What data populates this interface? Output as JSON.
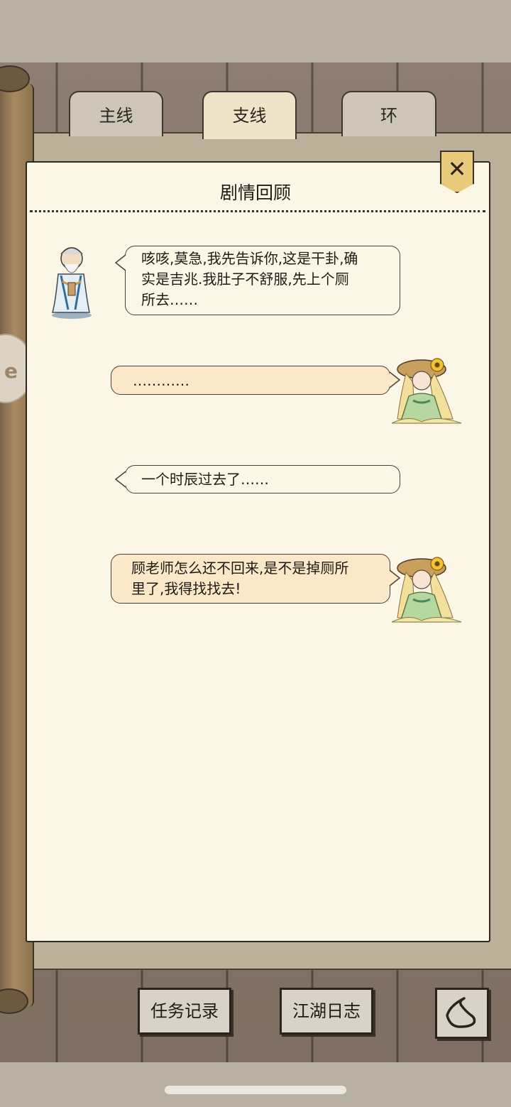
{
  "tabs": [
    {
      "label": "主线",
      "selected": false
    },
    {
      "label": "支线",
      "selected": true
    },
    {
      "label": "环",
      "selected": false
    }
  ],
  "panel": {
    "title": "剧情回顾",
    "close_label": "✕"
  },
  "dialogue": [
    {
      "speaker": "old-scholar",
      "side": "left",
      "lines": [
        "咳咳,莫急,我先告诉你,这是干卦,确",
        "实是吉兆.我肚子不舒服,先上个厕",
        "所去……"
      ]
    },
    {
      "speaker": "sunflower-girl",
      "side": "right",
      "lines": [
        "…………"
      ]
    },
    {
      "speaker": "",
      "side": "left",
      "lines": [
        "一个时辰过去了……"
      ]
    },
    {
      "speaker": "sunflower-girl",
      "side": "right",
      "lines": [
        "顾老师怎么还不回来,是不是掉厕所",
        "里了,我得找找去!"
      ]
    }
  ],
  "footer": {
    "task_log_label": "任务记录",
    "journal_label": "江湖日志",
    "back_icon": "back-arrow-icon"
  },
  "colors": {
    "paper": "#fcf6e6",
    "bubble_right": "#fbe8c8",
    "close_button": "#e9c97a",
    "wood": "#867669"
  }
}
